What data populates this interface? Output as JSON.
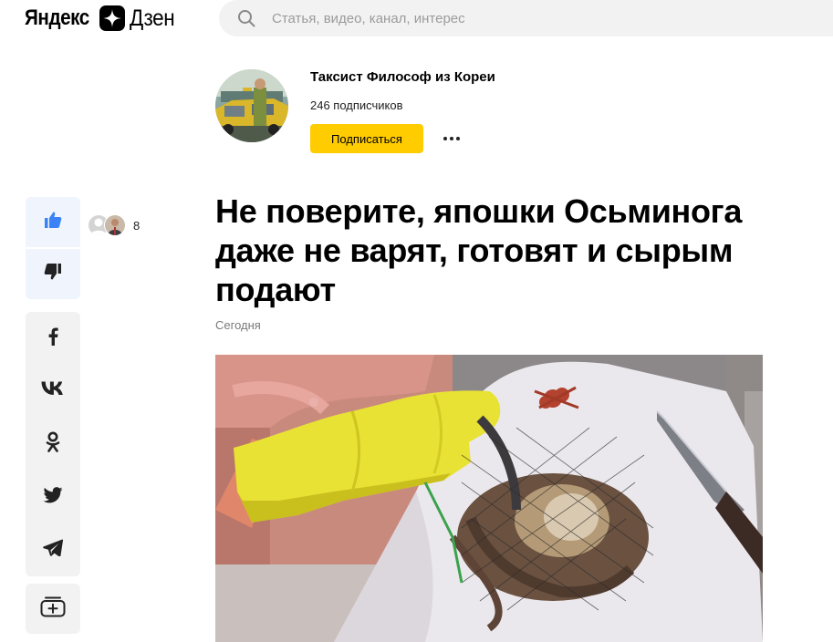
{
  "header": {
    "logo_yandex": "Яндекс",
    "logo_dzen": "Дзен",
    "search_placeholder": "Статья, видео, канал, интерес"
  },
  "channel": {
    "name": "Таксист Философ из Кореи",
    "subscribers": "246 подписчиков",
    "subscribe_label": "Подписаться"
  },
  "reactions": {
    "like_count": "8"
  },
  "share": {
    "items": [
      "facebook-icon",
      "vk-icon",
      "odnoklassniki-icon",
      "twitter-icon",
      "telegram-icon"
    ],
    "save_icon": "add-to-collection-icon"
  },
  "article": {
    "title": "Не поверите, япошки Осьминога даже не варят, готовят и сырым подают",
    "date": "Сегодня"
  },
  "colors": {
    "accent": "#ffcc00",
    "like_blue": "#3b82f6",
    "panel_bg": "#f2f2f2"
  }
}
